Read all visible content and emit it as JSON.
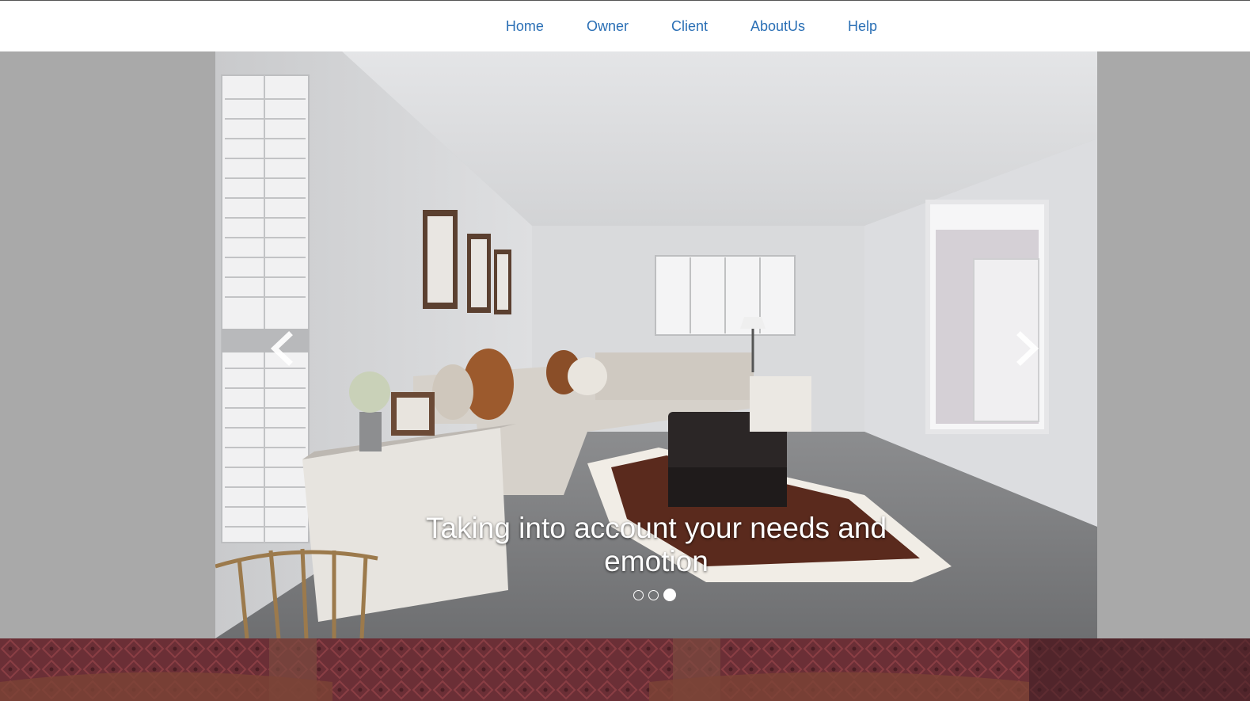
{
  "nav": {
    "items": [
      {
        "label": "Home"
      },
      {
        "label": "Owner"
      },
      {
        "label": "Client"
      },
      {
        "label": "AboutUs"
      },
      {
        "label": "Help"
      }
    ]
  },
  "carousel": {
    "caption": "Taking into account your needs and emotion",
    "slide_count": 3,
    "active_index": 3,
    "image": "living-room-photo",
    "prev_icon": "chevron-left-icon",
    "next_icon": "chevron-right-icon"
  },
  "colors": {
    "link": "#2a6fb5",
    "carousel_background": "#a9a9a9",
    "footer_background": "#5a2a31"
  }
}
